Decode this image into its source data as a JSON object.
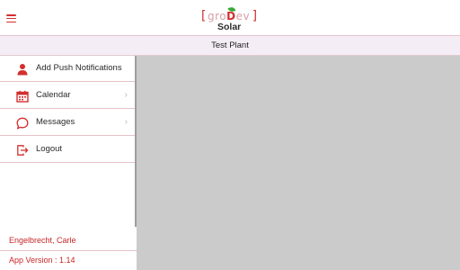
{
  "header": {
    "menu_icon": "hamburger-icon",
    "logo": {
      "bracket_left": "[",
      "name_prefix": "gro",
      "name_accent": "D",
      "name_suffix": "ev",
      "bracket_right": "]",
      "subtitle": "Solar"
    },
    "colors": {
      "accent": "#d32f2f",
      "leaf": "#39a935"
    }
  },
  "subheader": {
    "title": "Test Plant"
  },
  "drawer": {
    "items": [
      {
        "label": "Add Push Notifications",
        "icon": "person-icon",
        "has_chevron": false
      },
      {
        "label": "Calendar",
        "icon": "calendar-icon",
        "has_chevron": true,
        "chevron": "›"
      },
      {
        "label": "Messages",
        "icon": "chat-bubble-icon",
        "has_chevron": true,
        "chevron": "›"
      },
      {
        "label": "Logout",
        "icon": "logout-icon",
        "has_chevron": false
      }
    ],
    "user_name": "Engelbrecht, Carle",
    "app_version": "App Version : 1.14"
  }
}
